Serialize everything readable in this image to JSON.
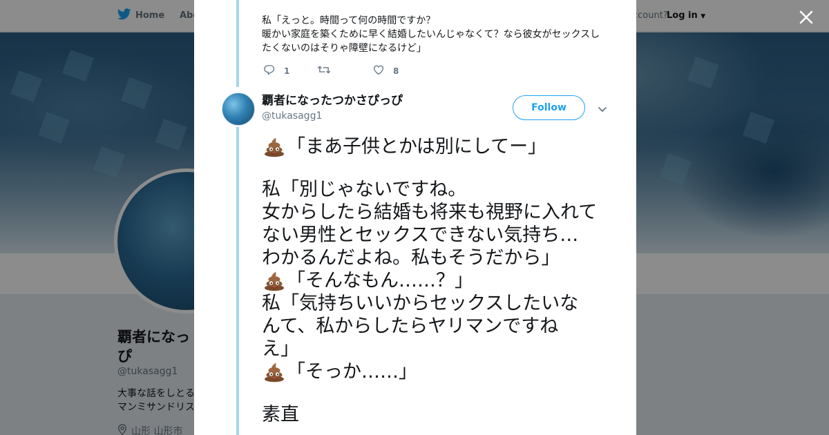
{
  "topbar": {
    "home_label": "Home",
    "about_label": "Abo",
    "account_label": "ccount?",
    "login_label": "Log in"
  },
  "background_profile": {
    "name": "覇者になっ\nぴ",
    "handle": "@tukasagg1",
    "bio_line1": "大事な話をしとる",
    "bio_line2": "マンミサンドリス",
    "location": "山形 山形市"
  },
  "modal": {
    "previous_tweet": {
      "text_line1": "私「えっと。時間って何の時間ですか？",
      "text_line2": "暖かい家庭を築くために早く結婚したいんじゃなくて？なら彼女がセックスし",
      "text_line3": "たくないのはそりゃ障壁になるけど」",
      "reply_count": "1",
      "retweet_count": "",
      "like_count": "8"
    },
    "tweet": {
      "author_name": "覇者になったつかさぴっぴ",
      "author_handle": "@tukasagg1",
      "follow_label": "Follow",
      "lines": [
        "「まあ子供とかは別にしてー」",
        "私「別じゃないですね。",
        "女からしたら結婚も将来も視野に入れて",
        "ない男性とセックスできない気持ち…",
        "わかるんだよね。私もそうだから」",
        "「そんなもん……？」",
        "私「気持ちいいからセックスしたいな",
        "んて、私からしたらヤリマンですね",
        "え」",
        "「そっか……」",
        "素直"
      ]
    }
  },
  "colors": {
    "accent": "#1da1f2",
    "thread_line": "#a5d4f2",
    "text_primary": "#14171a",
    "text_secondary": "#657786"
  },
  "icons": {
    "brand": "twitter-bird-icon",
    "close": "close-icon",
    "reply": "reply-icon",
    "retweet": "retweet-icon",
    "like": "heart-icon",
    "menu": "chevron-down-icon",
    "emoji": "pile-of-poo-emoji"
  }
}
